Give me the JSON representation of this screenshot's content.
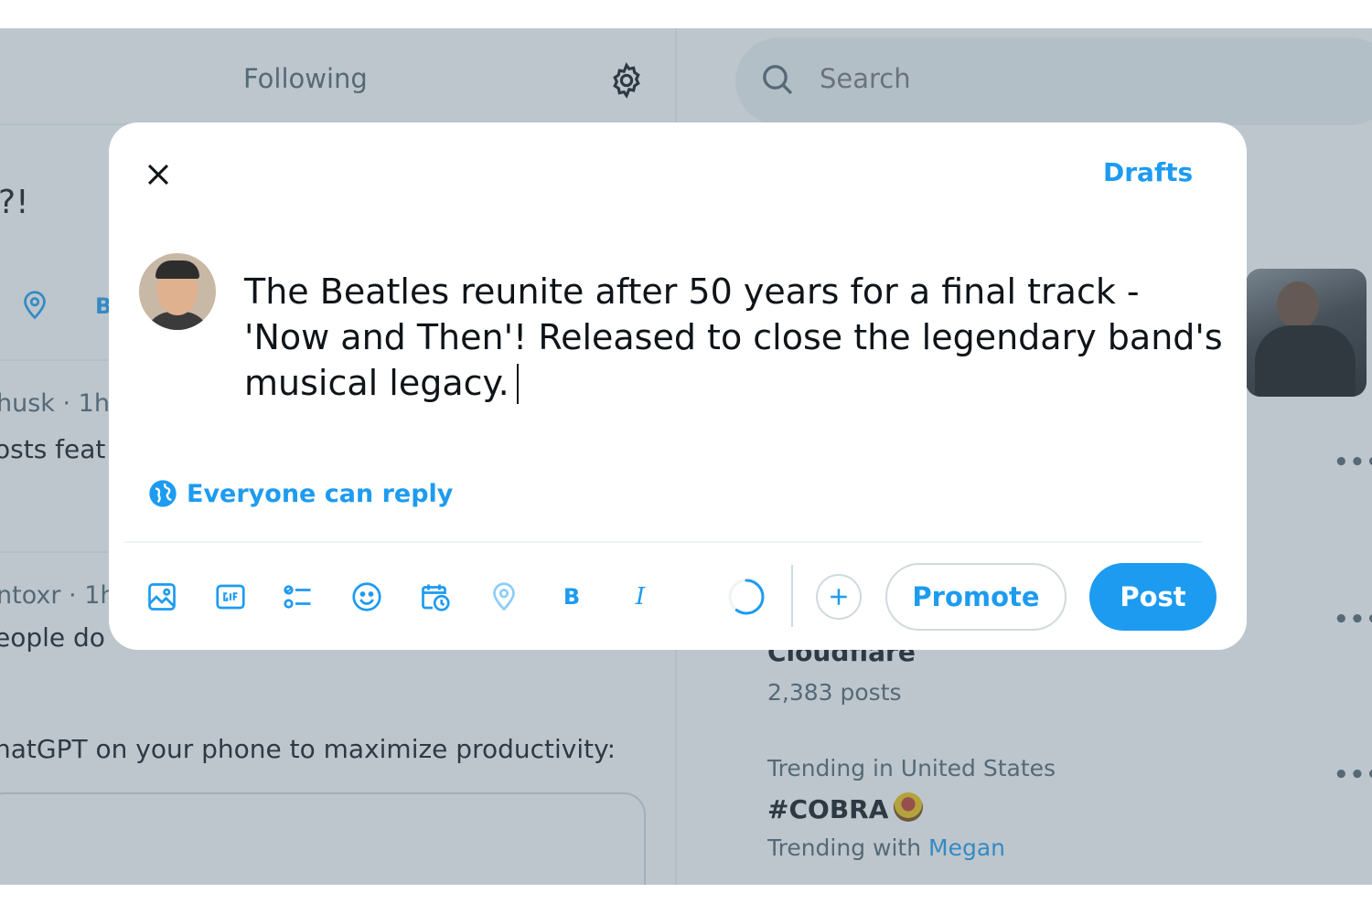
{
  "timeline": {
    "tab_following": "Following",
    "settings_icon": "gear-icon",
    "snippet_1": "?!",
    "snippet_b": "B",
    "post_1_meta": "husk · 1h",
    "post_1_text": "osts feat",
    "post_2_meta": "ntoxr · 1h",
    "post_2_text": "eople do",
    "post_3_text": "hatGPT on your phone to maximize productivity:"
  },
  "sidebar": {
    "search_placeholder": "Search",
    "trends": [
      {
        "name": "Cloudflare",
        "posts": "2,383 posts"
      },
      {
        "context": "Trending in United States",
        "name": "#COBRA",
        "trending_with_label": "Trending with",
        "trending_with_link": "Megan"
      }
    ],
    "more_icon": "•••"
  },
  "composer": {
    "close_icon": "close-icon",
    "drafts_label": "Drafts",
    "text": "The Beatles reunite after 50 years for a final track - 'Now and Then'! Released to close the legendary band's musical legacy.",
    "reply_setting": "Everyone can reply",
    "toolbar": {
      "bold_label": "B",
      "italic_label": "I",
      "promote_label": "Promote",
      "post_label": "Post",
      "character_progress": 0.6
    }
  },
  "colors": {
    "accent": "#1d9bf0",
    "overlay": "rgba(91,112,131,0.4)"
  }
}
